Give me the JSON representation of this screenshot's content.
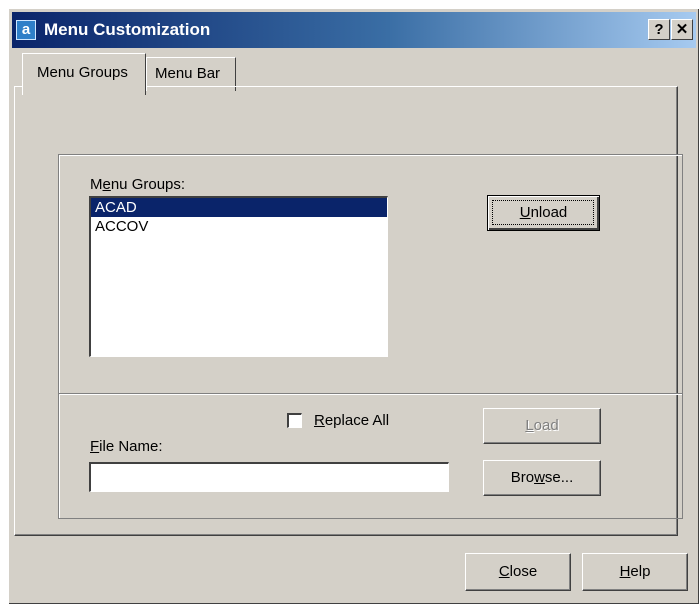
{
  "window": {
    "title": "Menu Customization",
    "help_button": "?",
    "close_button": "✕"
  },
  "tabs": [
    {
      "label": "Menu Groups",
      "active": true
    },
    {
      "label": "Menu Bar",
      "active": false
    }
  ],
  "menu_groups": {
    "label_pre": "M",
    "label_mnemonic": "e",
    "label_post": "nu Groups:",
    "items": [
      {
        "label": "ACAD",
        "selected": true
      },
      {
        "label": "ACCOV",
        "selected": false
      }
    ]
  },
  "buttons": {
    "unload": {
      "mnemonic": "U",
      "rest": "nload"
    },
    "load": {
      "mnemonic": "L",
      "rest": "oad"
    },
    "browse": {
      "pre": "Bro",
      "mnemonic": "w",
      "rest": "se..."
    },
    "close": {
      "mnemonic": "C",
      "rest": "lose"
    },
    "help": {
      "mnemonic": "H",
      "rest": "elp"
    }
  },
  "replace_all": {
    "mnemonic": "R",
    "rest": "eplace All",
    "checked": false
  },
  "file_name": {
    "mnemonic": "F",
    "rest": "ile Name:",
    "value": ""
  },
  "colors": {
    "face": "#d4d0c8",
    "title_gradient_start": "#0a246a",
    "title_gradient_end": "#a6caf0",
    "selection": "#0a246a"
  }
}
